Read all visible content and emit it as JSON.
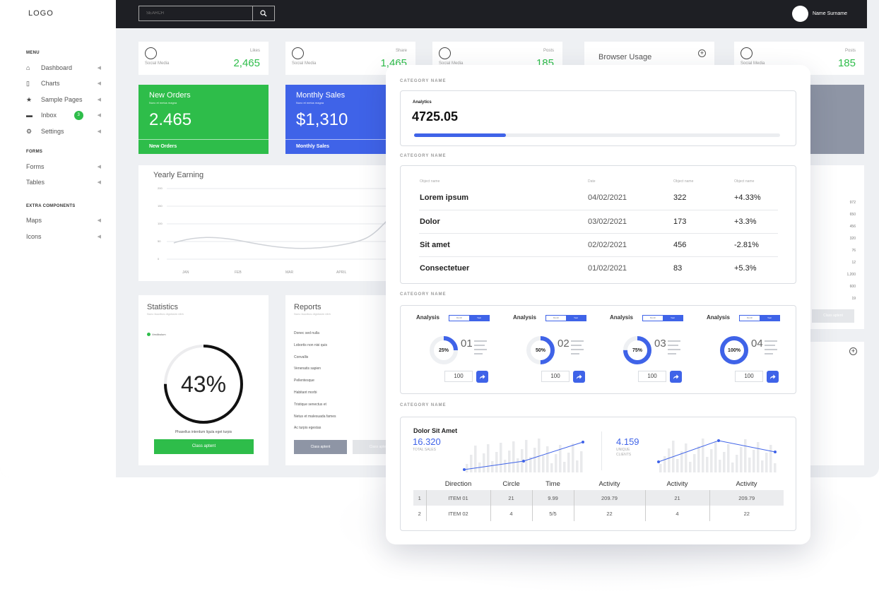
{
  "sidebar": {
    "logo": "LOGO",
    "menu_title": "MENU",
    "menu_items": [
      {
        "label": "Dashboard",
        "icon": "home-icon"
      },
      {
        "label": "Charts",
        "icon": "bar-chart-icon"
      },
      {
        "label": "Sample Pages",
        "icon": "star-icon"
      },
      {
        "label": "Inbox",
        "icon": "inbox-icon",
        "badge": "3"
      },
      {
        "label": "Settings",
        "icon": "key-icon"
      }
    ],
    "forms_title": "FORMS",
    "forms_items": [
      {
        "label": "Forms"
      },
      {
        "label": "Tables"
      }
    ],
    "extra_title": "EXTRA COMPONENTS",
    "extra_items": [
      {
        "label": "Maps"
      },
      {
        "label": "Icons"
      }
    ]
  },
  "topbar": {
    "search_placeholder": "SEARCH",
    "user_name": "Name Surname"
  },
  "stats": [
    {
      "sub": "Social Media",
      "title": "Likes",
      "value": "2,465"
    },
    {
      "sub": "Social Media",
      "title": "Share",
      "value": "1,465"
    },
    {
      "sub": "Social Media",
      "title": "Posts",
      "value": "185"
    },
    {
      "sub": "Social Media",
      "title": "Posts",
      "value": "185"
    }
  ],
  "browser_usage": {
    "title": "Browser Usage"
  },
  "new_orders": {
    "title": "New Orders",
    "sub": "Nunc et metus magna",
    "value": "2.465",
    "footer": "New Orders"
  },
  "monthly_sales": {
    "title": "Monthly Sales",
    "sub": "Nunc et metus magna",
    "value": "$1,310",
    "footer": "Monthly Sales"
  },
  "yearly": {
    "title": "Yearly Earning",
    "y_ticks": [
      "200",
      "150",
      "100",
      "50",
      "0"
    ],
    "x_ticks": [
      "JAN",
      "FEB",
      "MAR",
      "APRIL"
    ]
  },
  "statistics": {
    "title": "Statistics",
    "sub": "Nunc faucibus dignissim nibh",
    "legend": "Vestibulum",
    "value": "43%",
    "progress": 0.43,
    "caption": "Phasellus interdum ligula eget turpis",
    "button": "Class aptent"
  },
  "reports": {
    "title": "Reports",
    "sub": "Nunc faucibus dignissim nibh",
    "items": [
      "Donec sed nulla",
      "Lobortis non nisi quis",
      "Convallis",
      "Venenatis sapien",
      "Pellentesque",
      "Habitant morbi",
      "Tristique senectus et",
      "Netus et malesuada fames",
      "Ac turpis egestas"
    ],
    "button1": "Class aptent",
    "button2": "Class aptent"
  },
  "right_numbers": [
    "972",
    "650",
    "456",
    "320",
    "76",
    "12",
    "1,200",
    "600",
    "19"
  ],
  "right_button": "Class aptent",
  "panel": {
    "cat1": "CATEGORY NAME",
    "cat2": "CATEGORY NAME",
    "cat3": "CATEGORY NAME",
    "cat4": "CATEGORY NAME",
    "analytics": {
      "label": "Analytics",
      "value": "4725.05",
      "progress": 0.25
    },
    "table": {
      "headers": [
        "Object name",
        "Date",
        "Object name",
        "Object name"
      ],
      "rows": [
        [
          "Lorem ipsum",
          "04/02/2021",
          "322",
          "+4.33%"
        ],
        [
          "Dolor",
          "03/02/2021",
          "173",
          "+3.3%"
        ],
        [
          "Sit amet",
          "02/02/2021",
          "456",
          "-2.81%"
        ],
        [
          "Consectetuer",
          "01/02/2021",
          "83",
          "+5.3%"
        ]
      ]
    },
    "analysis": [
      {
        "label": "Analysis",
        "toggle_a": "Month",
        "toggle_b": "Year",
        "pct": "25%",
        "progress": 0.25,
        "num": "01",
        "input": "100"
      },
      {
        "label": "Analysis",
        "toggle_a": "Month",
        "toggle_b": "Year",
        "pct": "50%",
        "progress": 0.5,
        "num": "02",
        "input": "100"
      },
      {
        "label": "Analysis",
        "toggle_a": "Month",
        "toggle_b": "Year",
        "pct": "75%",
        "progress": 0.75,
        "num": "03",
        "input": "100"
      },
      {
        "label": "Analysis",
        "toggle_a": "Month",
        "toggle_b": "Year",
        "pct": "100%",
        "progress": 1.0,
        "num": "04",
        "input": "100"
      }
    ],
    "bottom": {
      "title": "Dolor Sit Amet",
      "sales_value": "16.320",
      "sales_label": "TOTAL SALES",
      "clients_value": "4.159",
      "clients_label_1": "UNIQUE",
      "clients_label_2": "CLIENTS",
      "headers": [
        "",
        "Direction",
        "Circle",
        "Time",
        "Activity",
        "Activity",
        "Activity"
      ],
      "rows": [
        [
          "1",
          "ITEM 01",
          "21",
          "9.99",
          "209.79",
          "21",
          "209.79"
        ],
        [
          "2",
          "ITEM 02",
          "4",
          "5/5",
          "22",
          "4",
          "22"
        ]
      ]
    }
  },
  "colors": {
    "green": "#2ebd4a",
    "blue": "#3f63e8",
    "dark": "#1e1f24",
    "grey_card": "#8e95a5"
  }
}
